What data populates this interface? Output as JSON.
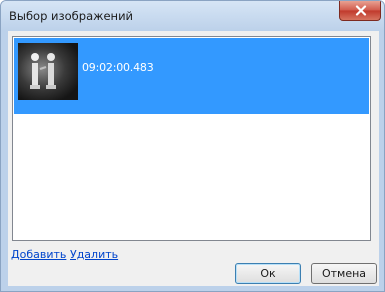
{
  "window": {
    "title": "Выбор изображений"
  },
  "image_list": {
    "items": [
      {
        "label": "09:02:00.483",
        "selected": true
      }
    ],
    "selection_color": "#3399ff"
  },
  "links": {
    "add": "Добавить",
    "remove": "Удалить"
  },
  "buttons": {
    "ok": "Ок",
    "cancel": "Отмена"
  },
  "icons": {
    "close": "close-icon"
  }
}
